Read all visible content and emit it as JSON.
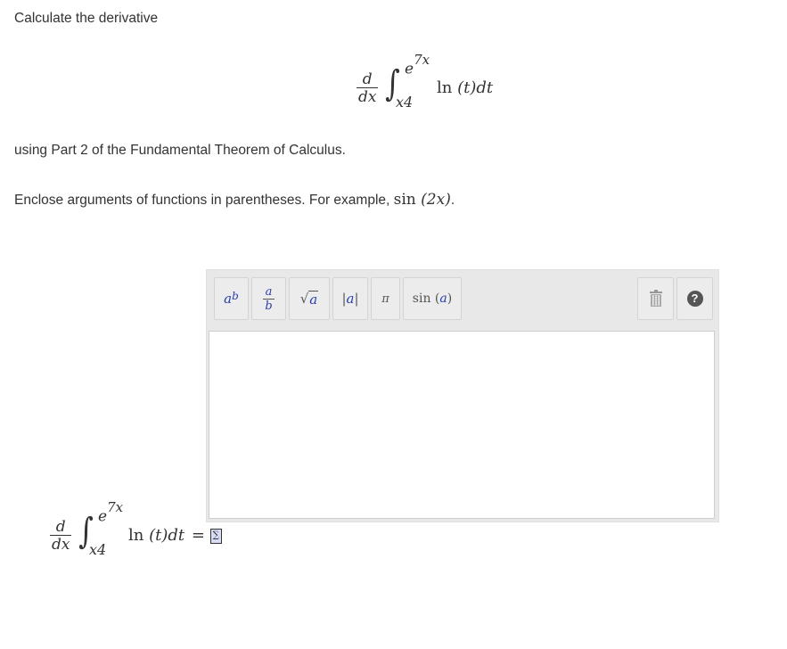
{
  "problem": {
    "intro": "Calculate the derivative",
    "integral": {
      "d_num": "d",
      "d_den": "dx",
      "upper_base": "e",
      "upper_exp": "7x",
      "lower": "x4",
      "integrand_fn": "ln",
      "integrand_arg": "(t)",
      "differential": "dt"
    },
    "method_text": "using Part 2 of the Fundamental Theorem of Calculus.",
    "instruction_text": "Enclose arguments of functions in parentheses. For example,",
    "example_fn": "sin",
    "example_arg": "(2x)",
    "example_end": "."
  },
  "toolbar": {
    "power": {
      "base": "a",
      "exp": "b"
    },
    "fraction": {
      "num": "a",
      "den": "b"
    },
    "sqrt": {
      "sym": "√",
      "arg": "a"
    },
    "abs": {
      "left": "|",
      "arg": "a",
      "right": "|"
    },
    "pi": "π",
    "sin": {
      "fn": "sin",
      "open": "(",
      "arg": "a",
      "close": ")"
    },
    "trash_icon": "trash-icon",
    "help_icon": "help-icon",
    "help_glyph": "?"
  },
  "answer": {
    "equals": "=",
    "sigma_glyph": "∑"
  },
  "colors": {
    "variable_blue": "#2a3fae",
    "help_circle": "#555555",
    "panel_bg": "#e8e8e8",
    "sigma_bg": "#d9dcf5"
  }
}
